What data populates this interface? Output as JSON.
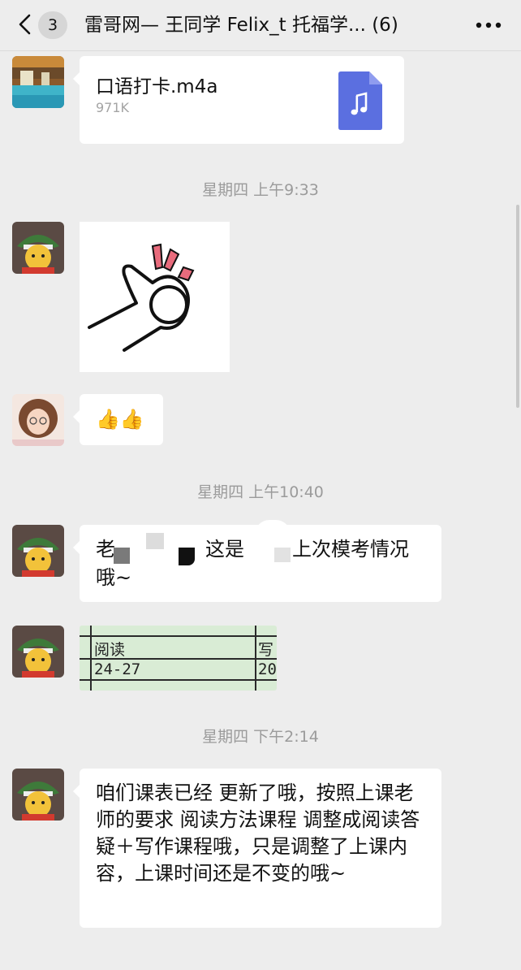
{
  "header": {
    "unread_count": "3",
    "title": "雷哥网— 王同学 Felix_t 托福学... (6)"
  },
  "messages": {
    "file": {
      "name": "口语打卡.m4a",
      "size": "971K"
    },
    "ts1": "星期四 上午9:33",
    "thumbs": "👍👍",
    "ts2": "星期四 上午10:40",
    "redacted": {
      "part1": "老",
      "part2": "这是",
      "part3": "上次模考情况",
      "part4": "哦~"
    },
    "table": {
      "col1_head": "阅读",
      "col1_val": "24-27",
      "col2_head": "写",
      "col2_val": "20"
    },
    "ts3": "星期四 下午2:14",
    "schedule": "咱们课表已经 更新了哦，按照上课老师的要求 阅读方法课程 调整成阅读答疑＋写作课程哦，只是调整了上课内容，上课时间还是不变的哦~"
  },
  "icons": {
    "back": "chevron-left-icon",
    "more": "more-dots-icon",
    "file": "music-file-icon"
  },
  "colors": {
    "background": "#ededed",
    "bubble": "#ffffff",
    "file_icon": "#5b6fe0",
    "timestamp": "#9b9b9b",
    "table_bg": "#d9ecd5"
  }
}
